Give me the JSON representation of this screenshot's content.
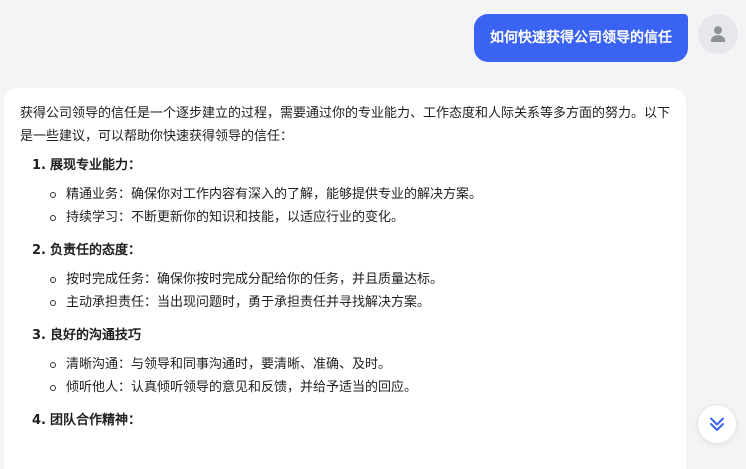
{
  "user_message": {
    "text": "如何快速获得公司领导的信任"
  },
  "answer": {
    "intro": "获得公司领导的信任是一个逐步建立的过程，需要通过你的专业能力、工作态度和人际关系等多方面的努力。以下是一些建议，可以帮助你快速获得领导的信任：",
    "sections": [
      {
        "num": "1.",
        "title": "展现专业能力：",
        "items": [
          "精通业务：确保你对工作内容有深入的了解，能够提供专业的解决方案。",
          "持续学习：不断更新你的知识和技能，以适应行业的变化。"
        ]
      },
      {
        "num": "2.",
        "title": "负责任的态度：",
        "items": [
          "按时完成任务：确保你按时完成分配给你的任务，并且质量达标。",
          "主动承担责任：当出现问题时，勇于承担责任并寻找解决方案。"
        ]
      },
      {
        "num": "3.",
        "title": "良好的沟通技巧",
        "items": [
          "清晰沟通：与领导和同事沟通时，要清晰、准确、及时。",
          "倾听他人：认真倾听领导的意见和反馈，并给予适当的回应。"
        ]
      },
      {
        "num": "4.",
        "title": "团队合作精神：",
        "items": []
      }
    ]
  },
  "icons": {
    "avatar": "user-avatar-icon",
    "scroll": "double-chevron-down-icon"
  },
  "colors": {
    "accent": "#3b63f3",
    "background": "#f3f4f6",
    "card": "#ffffff"
  }
}
